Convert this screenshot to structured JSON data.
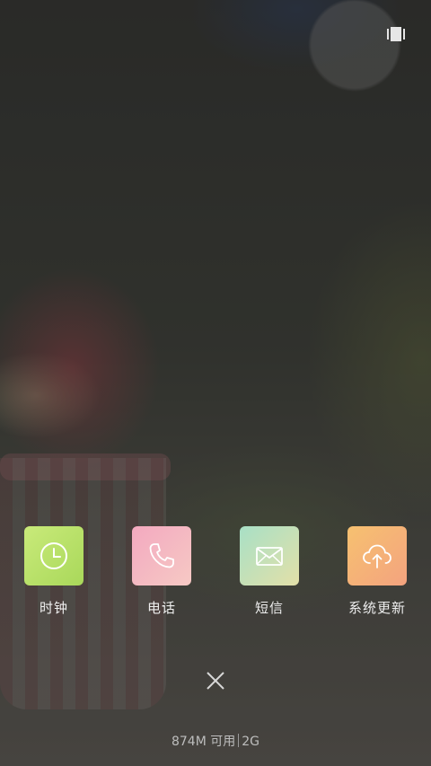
{
  "recents": {
    "icon": "recent-apps-icon"
  },
  "apps": [
    {
      "label": "时钟",
      "icon": "clock-icon",
      "gradient_from": "#c9ea7a",
      "gradient_to": "#a9d85a"
    },
    {
      "label": "电话",
      "icon": "phone-icon",
      "gradient_from": "#f3a9c0",
      "gradient_to": "#f6c3c3"
    },
    {
      "label": "短信",
      "icon": "mail-icon",
      "gradient_from": "#a8e0c6",
      "gradient_to": "#e3e0a8"
    },
    {
      "label": "系统更新",
      "icon": "cloud-upload-icon",
      "gradient_from": "#f6c170",
      "gradient_to": "#f4a37f"
    }
  ],
  "close": {
    "icon": "close-icon"
  },
  "memory": {
    "available": "874M 可用",
    "total": "2G"
  }
}
